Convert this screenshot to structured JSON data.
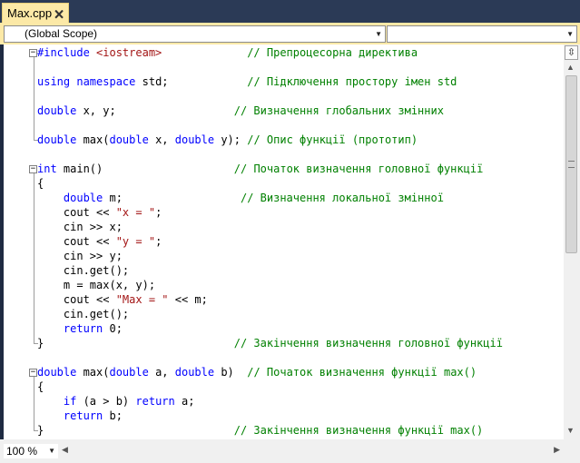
{
  "tab": {
    "title": "Max.cpp",
    "close_glyph": "🗙"
  },
  "navigation": {
    "scope": "(Global Scope)",
    "member": ""
  },
  "editor": {
    "lines": [
      {
        "fold": "⊟",
        "tokens": [
          {
            "t": "#include ",
            "c": "kw"
          },
          {
            "t": "<iostream>",
            "c": "str"
          },
          {
            "t": "             ",
            "c": ""
          },
          {
            "t": "// Препроцесорна директива",
            "c": "cm"
          }
        ]
      },
      {
        "tokens": []
      },
      {
        "tokens": [
          {
            "t": "using",
            "c": "kw"
          },
          {
            "t": " ",
            "c": ""
          },
          {
            "t": "namespace",
            "c": "kw"
          },
          {
            "t": " std;            ",
            "c": ""
          },
          {
            "t": "// Підключення простору імен std",
            "c": "cm"
          }
        ]
      },
      {
        "tokens": []
      },
      {
        "tokens": [
          {
            "t": "double",
            "c": "kw"
          },
          {
            "t": " x, y;                  ",
            "c": ""
          },
          {
            "t": "// Визначення глобальних змінних",
            "c": "cm"
          }
        ]
      },
      {
        "tokens": []
      },
      {
        "tokens": [
          {
            "t": "double",
            "c": "kw"
          },
          {
            "t": " max(",
            "c": ""
          },
          {
            "t": "double",
            "c": "kw"
          },
          {
            "t": " x, ",
            "c": ""
          },
          {
            "t": "double",
            "c": "kw"
          },
          {
            "t": " y); ",
            "c": ""
          },
          {
            "t": "// Опис функції (прототип)",
            "c": "cm"
          }
        ]
      },
      {
        "tokens": []
      },
      {
        "fold": "⊟",
        "tokens": [
          {
            "t": "int",
            "c": "kw"
          },
          {
            "t": " main()                    ",
            "c": ""
          },
          {
            "t": "// Початок визначення головної функції",
            "c": "cm"
          }
        ]
      },
      {
        "tokens": [
          {
            "t": "{",
            "c": ""
          }
        ]
      },
      {
        "tokens": [
          {
            "t": "    ",
            "c": ""
          },
          {
            "t": "double",
            "c": "kw"
          },
          {
            "t": " m;                  ",
            "c": ""
          },
          {
            "t": "// Визначення локальної змінної",
            "c": "cm"
          }
        ]
      },
      {
        "tokens": [
          {
            "t": "    cout << ",
            "c": ""
          },
          {
            "t": "\"x = \"",
            "c": "str"
          },
          {
            "t": ";",
            "c": ""
          }
        ]
      },
      {
        "tokens": [
          {
            "t": "    cin >> x;",
            "c": ""
          }
        ]
      },
      {
        "tokens": [
          {
            "t": "    cout << ",
            "c": ""
          },
          {
            "t": "\"y = \"",
            "c": "str"
          },
          {
            "t": ";",
            "c": ""
          }
        ]
      },
      {
        "tokens": [
          {
            "t": "    cin >> y;",
            "c": ""
          }
        ]
      },
      {
        "tokens": [
          {
            "t": "    cin.get();",
            "c": ""
          }
        ]
      },
      {
        "tokens": [
          {
            "t": "    m = max(x, y);",
            "c": ""
          }
        ]
      },
      {
        "tokens": [
          {
            "t": "    cout << ",
            "c": ""
          },
          {
            "t": "\"Max = \"",
            "c": "str"
          },
          {
            "t": " << m;",
            "c": ""
          }
        ]
      },
      {
        "tokens": [
          {
            "t": "    cin.get();",
            "c": ""
          }
        ]
      },
      {
        "tokens": [
          {
            "t": "    ",
            "c": ""
          },
          {
            "t": "return",
            "c": "kw"
          },
          {
            "t": " 0;",
            "c": ""
          }
        ]
      },
      {
        "tokens": [
          {
            "t": "}                             ",
            "c": ""
          },
          {
            "t": "// Закінчення визначення головної функції",
            "c": "cm"
          }
        ]
      },
      {
        "tokens": []
      },
      {
        "fold": "⊟",
        "tokens": [
          {
            "t": "double",
            "c": "kw"
          },
          {
            "t": " max(",
            "c": ""
          },
          {
            "t": "double",
            "c": "kw"
          },
          {
            "t": " a, ",
            "c": ""
          },
          {
            "t": "double",
            "c": "kw"
          },
          {
            "t": " b)  ",
            "c": ""
          },
          {
            "t": "// Початок визначення функції max()",
            "c": "cm"
          }
        ]
      },
      {
        "tokens": [
          {
            "t": "{",
            "c": ""
          }
        ]
      },
      {
        "tokens": [
          {
            "t": "    ",
            "c": ""
          },
          {
            "t": "if",
            "c": "kw"
          },
          {
            "t": " (a > b) ",
            "c": ""
          },
          {
            "t": "return",
            "c": "kw"
          },
          {
            "t": " a;",
            "c": ""
          }
        ]
      },
      {
        "tokens": [
          {
            "t": "    ",
            "c": ""
          },
          {
            "t": "return",
            "c": "kw"
          },
          {
            "t": " b;",
            "c": ""
          }
        ]
      },
      {
        "tokens": [
          {
            "t": "}                             ",
            "c": ""
          },
          {
            "t": "// Закінчення визначення функції max()",
            "c": "cm"
          }
        ]
      }
    ]
  },
  "status": {
    "zoom": "100 %"
  },
  "scrollbar": {
    "split_glyph": "⇳",
    "vertical_position": 0.0
  },
  "colors": {
    "keyword": "#0000ff",
    "string": "#a31515",
    "comment": "#008000",
    "tab_bg": "#fce9a7",
    "chrome_bg": "#2b3a56"
  }
}
